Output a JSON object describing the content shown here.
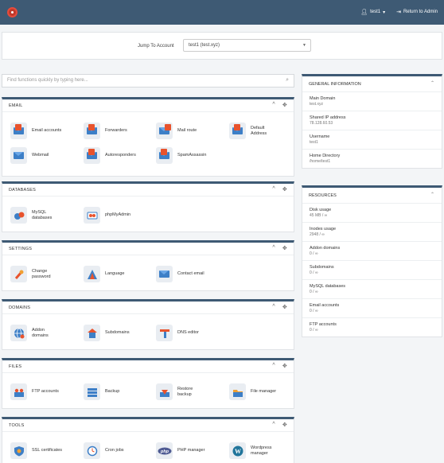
{
  "topbar": {
    "user": "test1",
    "user_caret": "▾",
    "return_label": "Return to Admin"
  },
  "jump": {
    "label": "Jump To Account",
    "value": "test1 (test.xyz)"
  },
  "search": {
    "placeholder": "Find functions quickly by typing here..."
  },
  "groups": [
    {
      "title": "EMAIL",
      "items": [
        {
          "label": "Email accounts",
          "icon": "email-accounts-icon"
        },
        {
          "label": "Forwarders",
          "icon": "forwarders-icon"
        },
        {
          "label": "Mail route",
          "icon": "mail-route-icon"
        },
        {
          "label": "Default Address",
          "icon": "default-address-icon"
        },
        {
          "label": "Webmail",
          "icon": "webmail-icon"
        },
        {
          "label": "Autoresponders",
          "icon": "autoresponders-icon"
        },
        {
          "label": "SpamAssassin",
          "icon": "spamassassin-icon"
        }
      ]
    },
    {
      "title": "DATABASES",
      "items": [
        {
          "label": "MySQL databases",
          "icon": "mysql-icon"
        },
        {
          "label": "phpMyAdmin",
          "icon": "phpmyadmin-icon"
        }
      ]
    },
    {
      "title": "SETTINGS",
      "items": [
        {
          "label": "Change password",
          "icon": "password-icon"
        },
        {
          "label": "Language",
          "icon": "language-icon"
        },
        {
          "label": "Contact email",
          "icon": "contact-email-icon"
        }
      ]
    },
    {
      "title": "DOMAINS",
      "items": [
        {
          "label": "Addon domains",
          "icon": "addon-domains-icon"
        },
        {
          "label": "Subdomains",
          "icon": "subdomains-icon"
        },
        {
          "label": "DNS editor",
          "icon": "dns-editor-icon"
        }
      ]
    },
    {
      "title": "FILES",
      "items": [
        {
          "label": "FTP accounts",
          "icon": "ftp-icon"
        },
        {
          "label": "Backup",
          "icon": "backup-icon"
        },
        {
          "label": "Restore backup",
          "icon": "restore-icon"
        },
        {
          "label": "File manager",
          "icon": "file-manager-icon"
        }
      ]
    },
    {
      "title": "TOOLS",
      "items": [
        {
          "label": "SSL certificates",
          "icon": "ssl-icon"
        },
        {
          "label": "Cron jobs",
          "icon": "cron-icon"
        },
        {
          "label": "PHP manager",
          "icon": "php-icon"
        },
        {
          "label": "Wordpress manager",
          "icon": "wordpress-icon"
        }
      ]
    }
  ],
  "general": {
    "title": "GENERAL INFORMATION",
    "rows": [
      {
        "k": "Main Domain",
        "v": "test.xyz"
      },
      {
        "k": "Shared IP address",
        "v": "78.128.60.53"
      },
      {
        "k": "Username",
        "v": "test1"
      },
      {
        "k": "Home Directory",
        "v": "/home/test1"
      }
    ]
  },
  "resources": {
    "title": "RESOURCES",
    "rows": [
      {
        "k": "Disk usage",
        "v": "45 MB / ∞"
      },
      {
        "k": "Inodes usage",
        "v": "2948 / ∞"
      },
      {
        "k": "Addon domains",
        "v": "0 / ∞"
      },
      {
        "k": "Subdomains",
        "v": "0 / ∞"
      },
      {
        "k": "MySQL databases",
        "v": "0 / ∞"
      },
      {
        "k": "Email accounts",
        "v": "0 / ∞"
      },
      {
        "k": "FTP accounts",
        "v": "0 / ∞"
      }
    ]
  },
  "controls": {
    "collapse": "^",
    "move": "✥",
    "sidebar_collapse": "⌃"
  }
}
